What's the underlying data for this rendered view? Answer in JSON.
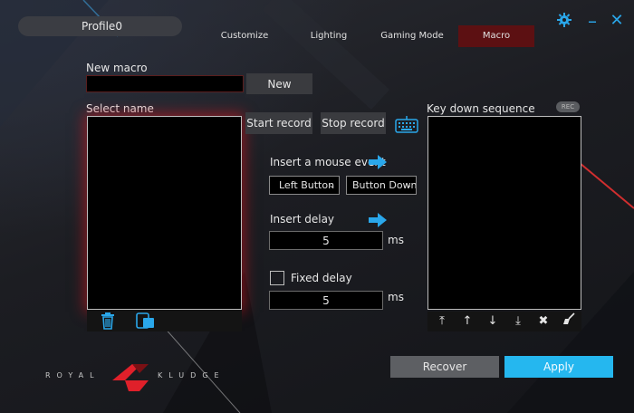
{
  "header": {
    "profile_name": "Profile0",
    "tabs": [
      {
        "label": "Customize"
      },
      {
        "label": "Lighting"
      },
      {
        "label": "Gaming Mode"
      },
      {
        "label": "Macro"
      }
    ],
    "active_tab": "Macro",
    "accent_color": "#2aa7ea",
    "active_tab_color": "#5c1012"
  },
  "macro": {
    "new_macro_label": "New macro",
    "new_macro_value": "",
    "new_button": "New",
    "select_name_label": "Select name",
    "start_record": "Start record",
    "stop_record": "Stop record",
    "insert_mouse_event": "Insert a mouse event",
    "mouse_button_select": "Left Button",
    "mouse_action_select": "Button Down",
    "insert_delay": "Insert delay",
    "delay_value": "5",
    "delay_unit": "ms",
    "fixed_delay": "Fixed delay",
    "fixed_delay_checked": false,
    "fixed_delay_value": "5",
    "fixed_delay_unit": "ms",
    "key_down_sequence": "Key down sequence",
    "rec_badge": "REC"
  },
  "footer": {
    "recover_button": "Recover",
    "apply_button": "Apply",
    "brand_left": "ROYAL",
    "brand_right": "KLUDGE"
  }
}
